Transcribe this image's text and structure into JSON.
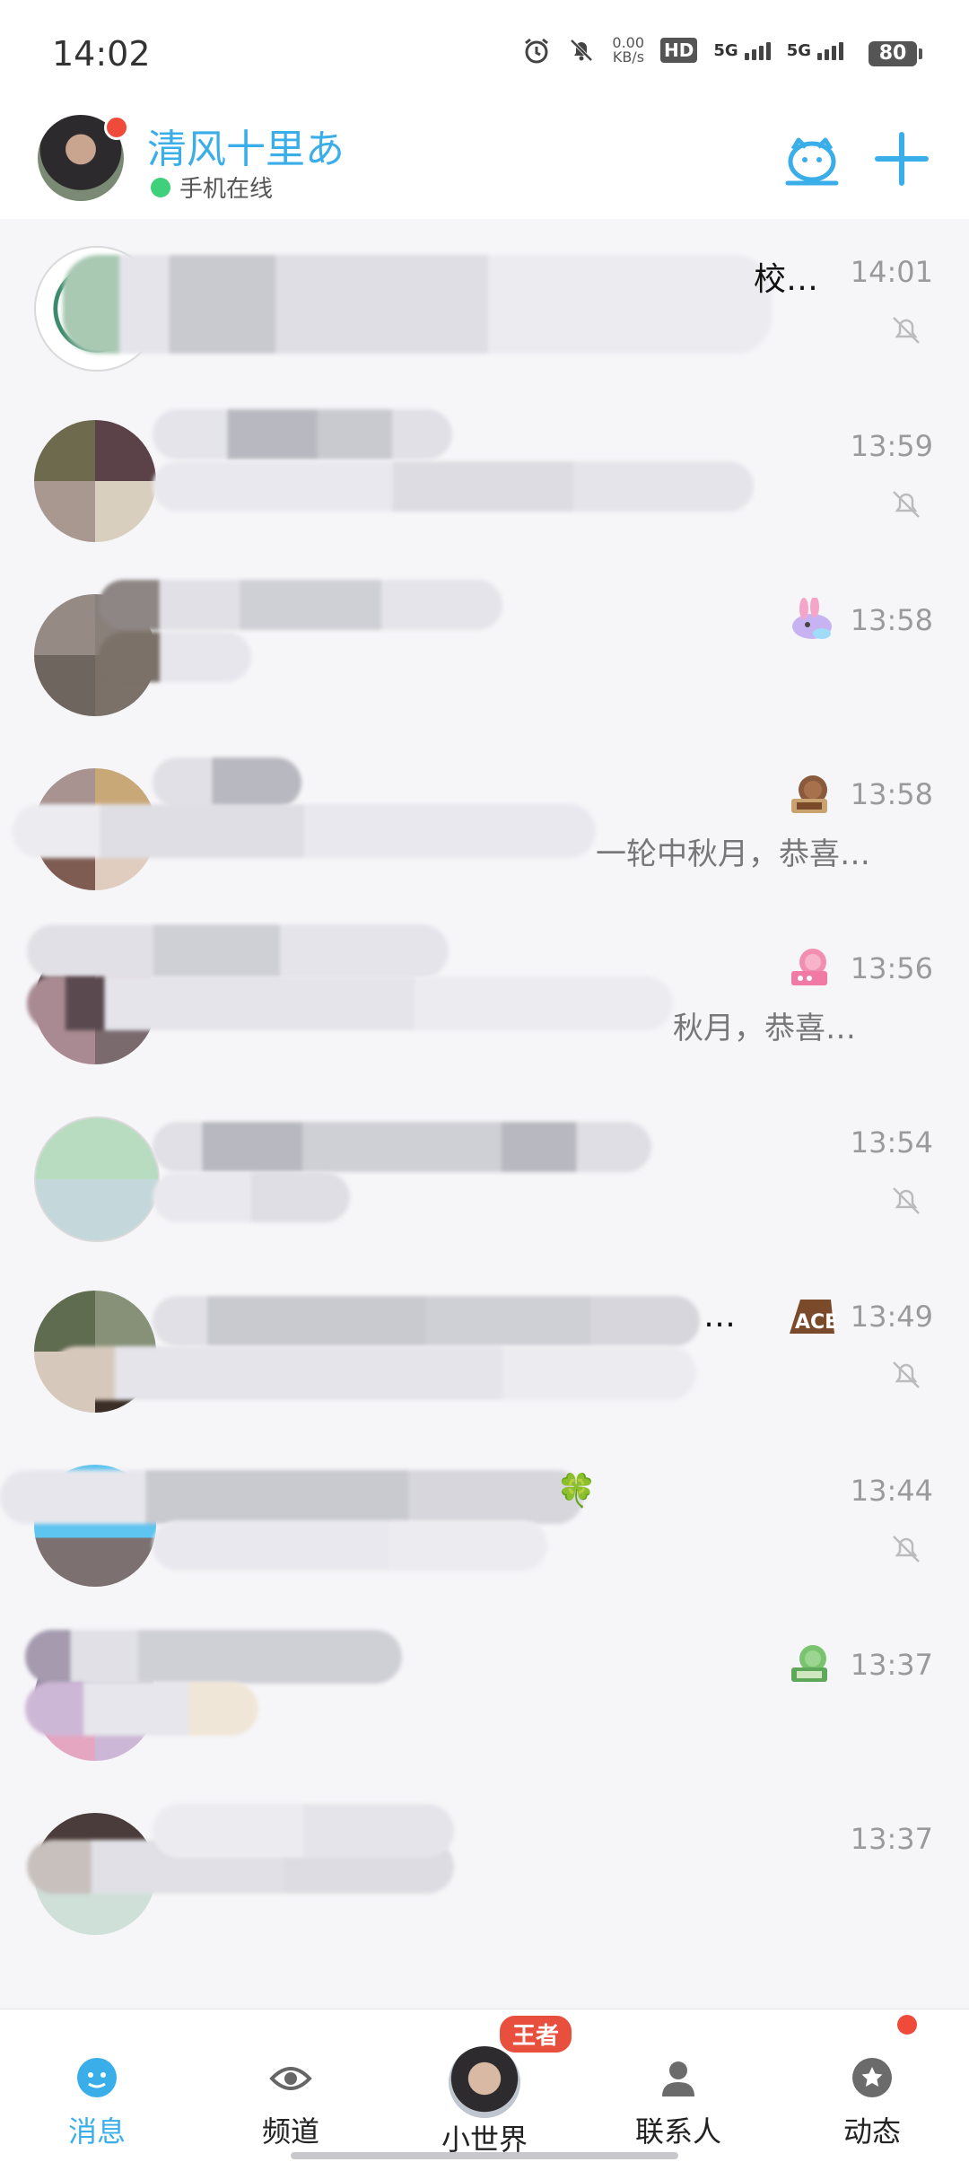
{
  "status_bar": {
    "time": "14:02",
    "net_speed_value": "0.00",
    "net_speed_unit": "KB/s",
    "hd_label": "HD",
    "network_1": "5G",
    "network_2": "5G",
    "battery": "80"
  },
  "header": {
    "username": "清风十里あ",
    "status": "手机在线",
    "icons": [
      "qq-mascot-icon",
      "plus-icon"
    ]
  },
  "conversations": [
    {
      "name": "校…",
      "preview": "",
      "time": "14:01",
      "muted": true,
      "sticker": ""
    },
    {
      "name": "",
      "preview": "",
      "time": "13:59",
      "muted": true,
      "sticker": ""
    },
    {
      "name": "",
      "preview": "",
      "time": "13:58",
      "muted": false,
      "sticker": "rabbit-sticker-icon"
    },
    {
      "name": "",
      "preview": "一轮中秋月，恭喜…",
      "time": "13:58",
      "muted": false,
      "sticker": "mooncake-sticker-icon"
    },
    {
      "name": "",
      "preview": "秋月，恭喜…",
      "time": "13:56",
      "muted": false,
      "sticker": "pink-mooncake-sticker-icon"
    },
    {
      "name": "",
      "preview": "",
      "time": "13:54",
      "muted": true,
      "sticker": ""
    },
    {
      "name": "…",
      "preview": "",
      "time": "13:49",
      "muted": true,
      "sticker": "ace-sticker-icon"
    },
    {
      "name": "🍀",
      "preview": "",
      "time": "13:44",
      "muted": true,
      "sticker": ""
    },
    {
      "name": "",
      "preview": "",
      "time": "13:37",
      "muted": false,
      "sticker": "green-mooncake-sticker-icon"
    },
    {
      "name": "",
      "preview": "",
      "time": "13:37",
      "muted": false,
      "sticker": ""
    }
  ],
  "bottom_nav": {
    "items": [
      {
        "label": "消息",
        "icon": "message-icon",
        "active": true
      },
      {
        "label": "频道",
        "icon": "channel-eye-icon",
        "active": false
      },
      {
        "label": "小世界",
        "icon": "world-avatar",
        "badge": "王者",
        "active": false
      },
      {
        "label": "联系人",
        "icon": "contacts-icon",
        "active": false
      },
      {
        "label": "动态",
        "icon": "star-circle-icon",
        "active": false
      }
    ]
  },
  "colors": {
    "accent": "#3aaee8",
    "badge_red": "#e8503d",
    "online_green": "#3ed07a"
  }
}
